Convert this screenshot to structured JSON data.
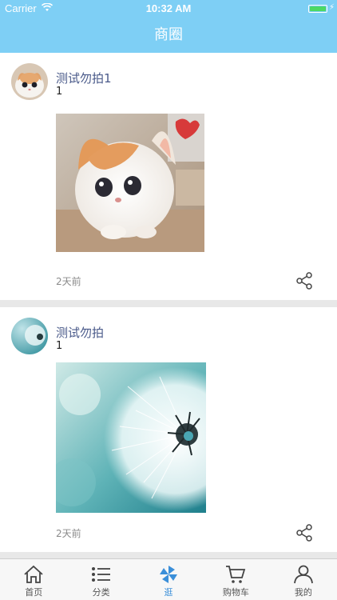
{
  "status_bar": {
    "carrier": "Carrier",
    "time": "10:32 AM",
    "battery_level": 1.0
  },
  "nav": {
    "title": "商圈"
  },
  "posts": [
    {
      "username": "测试勿拍1",
      "content": "1",
      "time_ago": "2天前",
      "avatar": "cat-photo",
      "image": "cat-photo"
    },
    {
      "username": "测试勿拍",
      "content": "1",
      "time_ago": "2天前",
      "avatar": "dandelion-photo",
      "image": "dandelion-photo"
    }
  ],
  "tabbar": {
    "items": [
      {
        "label": "首页",
        "icon": "home-icon",
        "active": false
      },
      {
        "label": "分类",
        "icon": "list-icon",
        "active": false
      },
      {
        "label": "逛",
        "icon": "pinwheel-icon",
        "active": true
      },
      {
        "label": "购物车",
        "icon": "cart-icon",
        "active": false
      },
      {
        "label": "我的",
        "icon": "user-icon",
        "active": false
      }
    ]
  },
  "colors": {
    "accent": "#7ecff5",
    "active_tab": "#3b8fd9",
    "username": "#4a5a8a"
  }
}
